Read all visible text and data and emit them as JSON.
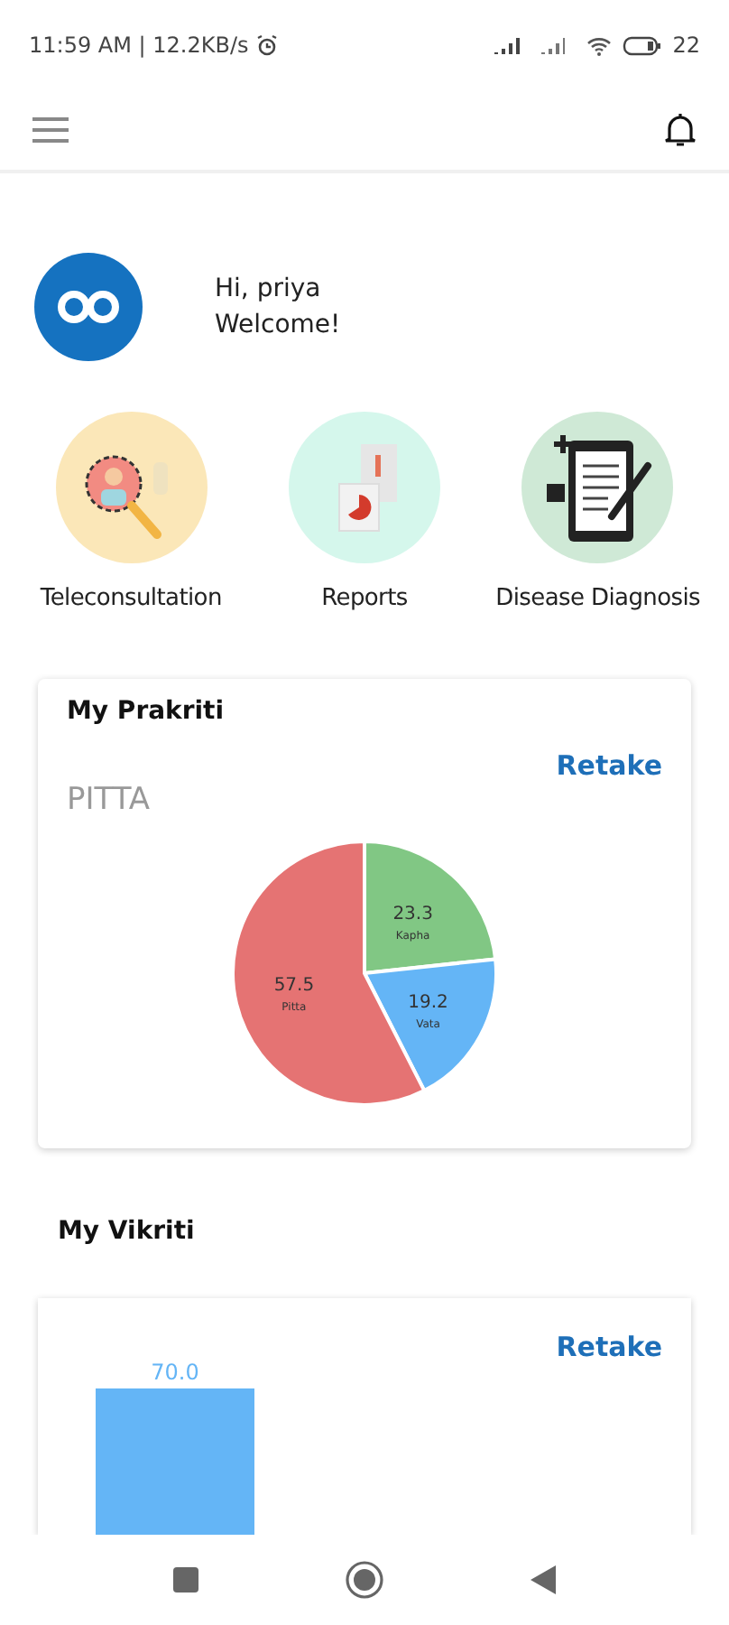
{
  "status_bar": {
    "time": "11:59 AM | 12.2KB/s",
    "battery": "22"
  },
  "greeting": {
    "line_1": "Hi, priya",
    "line_2": "Welcome!"
  },
  "tiles": [
    {
      "label": "Teleconsultation",
      "kind": "doctor"
    },
    {
      "label": "Reports",
      "kind": "reports"
    },
    {
      "label": "Disease Diagnosis",
      "kind": "clipboard"
    }
  ],
  "prakriti": {
    "title": "My Prakriti",
    "action": "Retake",
    "result": "PITTA",
    "chart_data": {
      "type": "pie",
      "categories": [
        "Kapha",
        "Vata",
        "Pitta"
      ],
      "series": [
        {
          "values": [
            23.3,
            19.2,
            57.5
          ]
        }
      ],
      "colors": [
        "#81c784",
        "#64b5f6",
        "#e57373"
      ],
      "value_labels": [
        "23.3",
        "19.2",
        "57.5"
      ],
      "data_labels": true
    }
  },
  "vikriti": {
    "title": "My Vikriti",
    "action": "Retake",
    "bar_label": "70.0"
  }
}
